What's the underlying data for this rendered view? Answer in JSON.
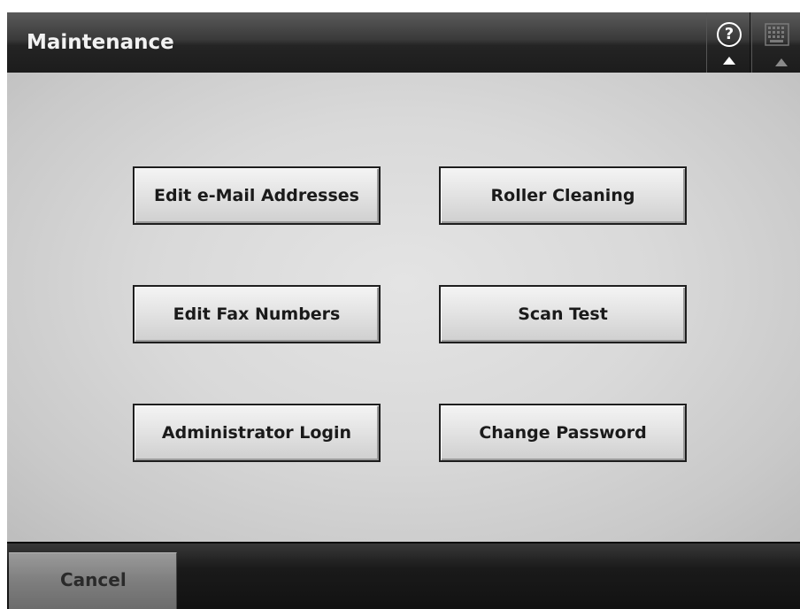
{
  "header": {
    "title": "Maintenance",
    "help_icon": "question-mark-circle-icon",
    "help_glyph": "?",
    "keyboard_icon": "keyboard-icon"
  },
  "menu": {
    "items": [
      {
        "label": "Edit e-Mail Addresses"
      },
      {
        "label": "Roller Cleaning"
      },
      {
        "label": "Edit Fax Numbers"
      },
      {
        "label": "Scan Test"
      },
      {
        "label": "Administrator Login"
      },
      {
        "label": "Change Password"
      }
    ]
  },
  "footer": {
    "cancel_label": "Cancel"
  },
  "colors": {
    "title_bar": "#2a2a2a",
    "content_bg": "#d9d9d9",
    "button_border": "#1e1e1e",
    "cancel_bg": "#7e7e7e"
  }
}
